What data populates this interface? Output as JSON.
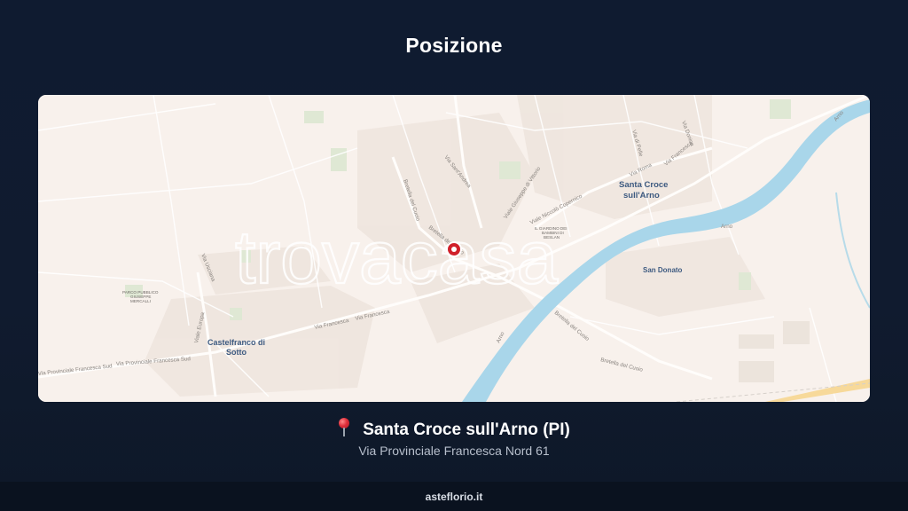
{
  "page": {
    "title": "Posizione"
  },
  "map": {
    "watermark": "trovacasa",
    "marker_color": "#d0202a",
    "water_color": "#a9d6ea",
    "labels": {
      "town_santa_croce_line1": "Santa Croce",
      "town_santa_croce_line2": "sull'Arno",
      "town_castelfranco_line1": "Castelfranco di",
      "town_castelfranco_line2": "Sotto",
      "town_san_donato": "San Donato",
      "park_line1": "PARCO PUBBLICO",
      "park_line2": "GIUSEPPE",
      "park_line3": "MERCALLI",
      "garden_line1": "IL GIARDINO DEI",
      "garden_line2": "BAMBINI DI",
      "garden_line3": "BESLAN",
      "street_via_francesca_1": "Via Francesca",
      "street_via_francesca_2": "Via Francesca",
      "street_via_prov_fr_sud_1": "Via Provinciale Francesca Sud",
      "street_via_prov_fr_sud_2": "Via Provinciale Francesca Sud",
      "street_bretella_cuoio_1": "Bretella del Cuoio",
      "street_bretella_cuoio_2": "Bretella del Cuoio",
      "street_bretella_cuoio_3": "Bretella del Cuoio",
      "street_bretella_cuoio_4": "Bretella del Cuoio",
      "street_viale_europa": "Viale Europa",
      "street_via_usciana": "Via Usciana",
      "street_via_san_andrea": "Via Sant'Andrea",
      "street_viale_giuseppe_vittorio": "Viale Giuseppe di Vittorio",
      "street_viale_niccolo_copernico": "Viale Niccolò Copernico",
      "street_via_di_pelle": "Via di Pelle",
      "street_via_roma": "Via Roma",
      "street_via_francesca_nord": "Via Francesca",
      "street_via_donica": "Via Donica",
      "street_arno_1": "Arno",
      "street_arno_2": "Arno",
      "street_arno_3": "Arno"
    }
  },
  "location": {
    "name": "Santa Croce sull'Arno (PI)",
    "address": "Via Provinciale Francesca Nord 61"
  },
  "footer": {
    "site": "asteflorio.it"
  }
}
